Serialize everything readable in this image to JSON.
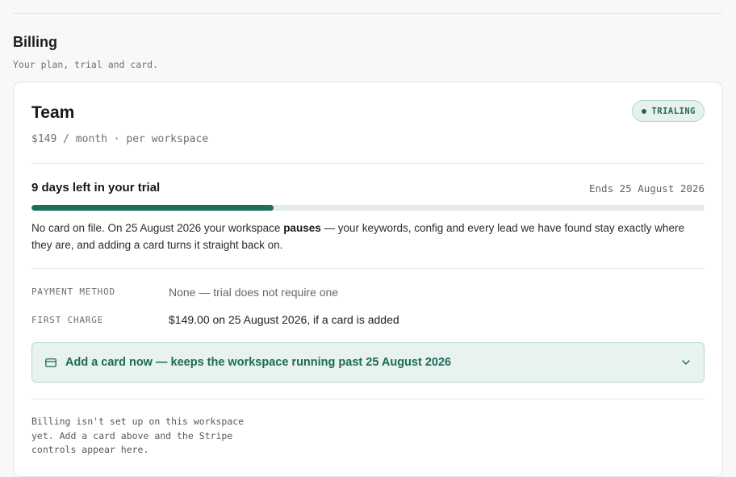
{
  "section": {
    "title": "Billing",
    "subtitle": "Your plan, trial and card."
  },
  "plan": {
    "name": "Team",
    "price": "$149 / month · per workspace",
    "status_badge": "TRIALING"
  },
  "trial": {
    "title": "9 days left in your trial",
    "ends": "Ends 25 August 2026",
    "progress_fraction": 0.36
  },
  "notice": {
    "before": "No card on file. On 25 August 2026 your workspace ",
    "emphasis": "pauses",
    "after": " — your keywords, config and every lead we have found stay exactly where they are, and adding a card turns it straight back on."
  },
  "details": {
    "payment_method_label": "PAYMENT METHOD",
    "payment_method_value": "None — trial does not require one",
    "first_charge_label": "FIRST CHARGE",
    "first_charge_value": "$149.00 on 25 August 2026, if a card is added"
  },
  "add_card": {
    "label": "Add a card now — keeps the workspace running past 25 August 2026",
    "icon": "credit-card-icon",
    "chevron": "chevron-down-icon"
  },
  "footnote": "Billing isn't set up on this workspace yet. Add a card above and the Stripe controls appear here.",
  "colors": {
    "accent": "#1c6f5c",
    "accent_bg": "#e8f2ef"
  }
}
